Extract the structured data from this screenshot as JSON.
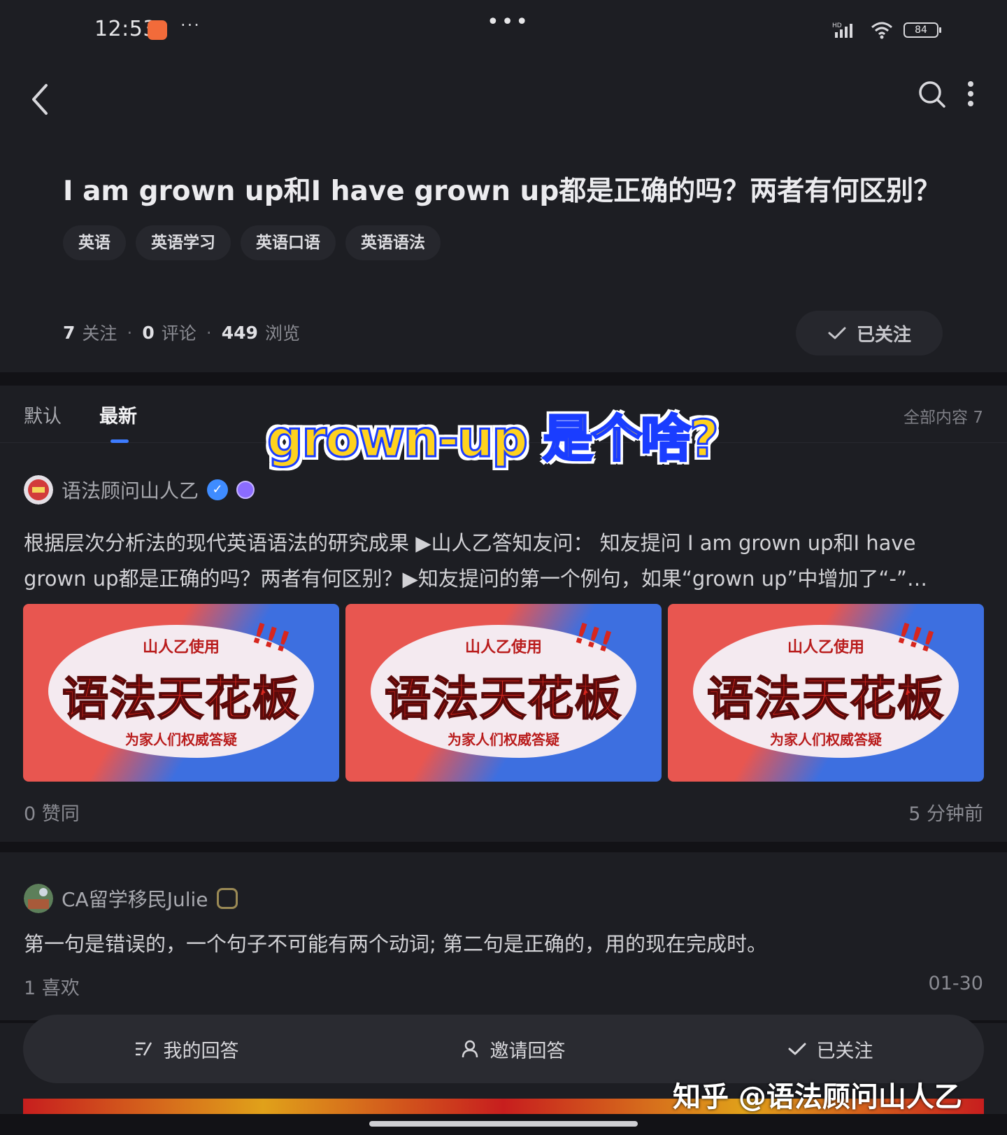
{
  "status_bar": {
    "time": "12:53",
    "small_dots": "···",
    "center_dots": "•••",
    "network": "HD",
    "battery": "84"
  },
  "question": {
    "title": "I am grown up和I have grown up都是正确的吗？两者有何区别？",
    "tags": [
      "英语",
      "英语学习",
      "英语口语",
      "英语语法"
    ],
    "followers_count": "7",
    "followers_label": "关注",
    "comments_count": "0",
    "comments_label": "评论",
    "views_count": "449",
    "views_label": "浏览",
    "follow_button_label": "已关注"
  },
  "tabs": {
    "default_label": "默认",
    "latest_label": "最新",
    "all_content_label": "全部内容 7"
  },
  "overlay_caption": "grown-up 是个啥?",
  "answers": [
    {
      "author": "语法顾问山人乙",
      "excerpt": "根据层次分析法的现代英语语法的研究成果 ▶山人乙答知友问： 知友提问 I am grown up和I have grown up都是正确的吗？两者有何区别？▶知友提问的第一个例句，如果“grown up”中增加了“-”…",
      "image_top_text": "山人乙使用",
      "image_main_text": "语法天花板",
      "image_bottom_text": "为家人们权威答疑",
      "image_exclaim": "!!!",
      "likes": "0 赞同",
      "time": "5 分钟前"
    },
    {
      "author": "CA留学移民Julie",
      "text": "第一句是错误的，一个句子不可能有两个动词; 第二句是正确的，用的现在完成时。",
      "likes": "1  喜欢",
      "date": "01-30"
    }
  ],
  "bottom_actions": {
    "my_answer": "我的回答",
    "invite_answer": "邀请回答",
    "followed": "已关注"
  },
  "watermark": "知乎 @语法顾问山人乙",
  "colors": {
    "background": "#1d1e23",
    "accent_blue": "#3d7cff",
    "caption_yellow": "#ffd21e"
  }
}
